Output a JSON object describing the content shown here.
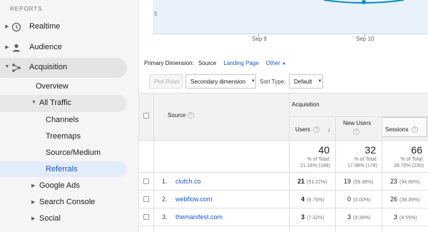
{
  "sidebar": {
    "header": "REPORTS",
    "realtime": "Realtime",
    "audience": "Audience",
    "acquisition": "Acquisition",
    "overview": "Overview",
    "all_traffic": "All Traffic",
    "channels": "Channels",
    "treemaps": "Treemaps",
    "source_medium": "Source/Medium",
    "referrals": "Referrals",
    "google_ads": "Google Ads",
    "search_console": "Search Console",
    "social": "Social"
  },
  "chart": {
    "y_tick": "5",
    "x_ticks": [
      "Sep 9",
      "Sep 10"
    ],
    "accent": "#058dc7"
  },
  "dimension": {
    "label": "Primary Dimension:",
    "current": "Source",
    "landing_page": "Landing Page",
    "other": "Other"
  },
  "controls": {
    "plot_rows": "Plot Rows",
    "secondary_dimension": "Secondary dimension",
    "sort_type_label": "Sort Type:",
    "sort_default": "Default"
  },
  "table": {
    "group_header": "Acquisition",
    "col_source": "Source",
    "col_users": "Users",
    "col_new_users": "New Users",
    "col_sessions": "Sessions",
    "totals": {
      "users": "40",
      "users_pct_line1": "% of Total:",
      "users_pct_line2": "21.16% (189)",
      "new_users": "32",
      "new_users_pct_line1": "% of Total:",
      "new_users_pct_line2": "17.98% (178)",
      "sessions": "66",
      "sessions_pct_line1": "% of Total:",
      "sessions_pct_line2": "28.70% (230)"
    },
    "rows": [
      {
        "num": "1.",
        "source": "clutch.co",
        "users": "21",
        "users_pct": "(51.22%)",
        "new_users": "19",
        "new_users_pct": "(59.38%)",
        "sessions": "23",
        "sessions_pct": "(34.85%)"
      },
      {
        "num": "2.",
        "source": "webflow.com",
        "users": "4",
        "users_pct": "(9.76%)",
        "new_users": "0",
        "new_users_pct": "(0.00%)",
        "sessions": "26",
        "sessions_pct": "(39.39%)"
      },
      {
        "num": "3.",
        "source": "themanifest.com",
        "users": "3",
        "users_pct": "(7.32%)",
        "new_users": "3",
        "new_users_pct": "(9.38%)",
        "sessions": "3",
        "sessions_pct": "(4.55%)"
      }
    ]
  },
  "colors": {
    "link": "#1a56c9",
    "selected_bg": "#e3ecfb",
    "chart_fill": "#e9f1fb"
  }
}
